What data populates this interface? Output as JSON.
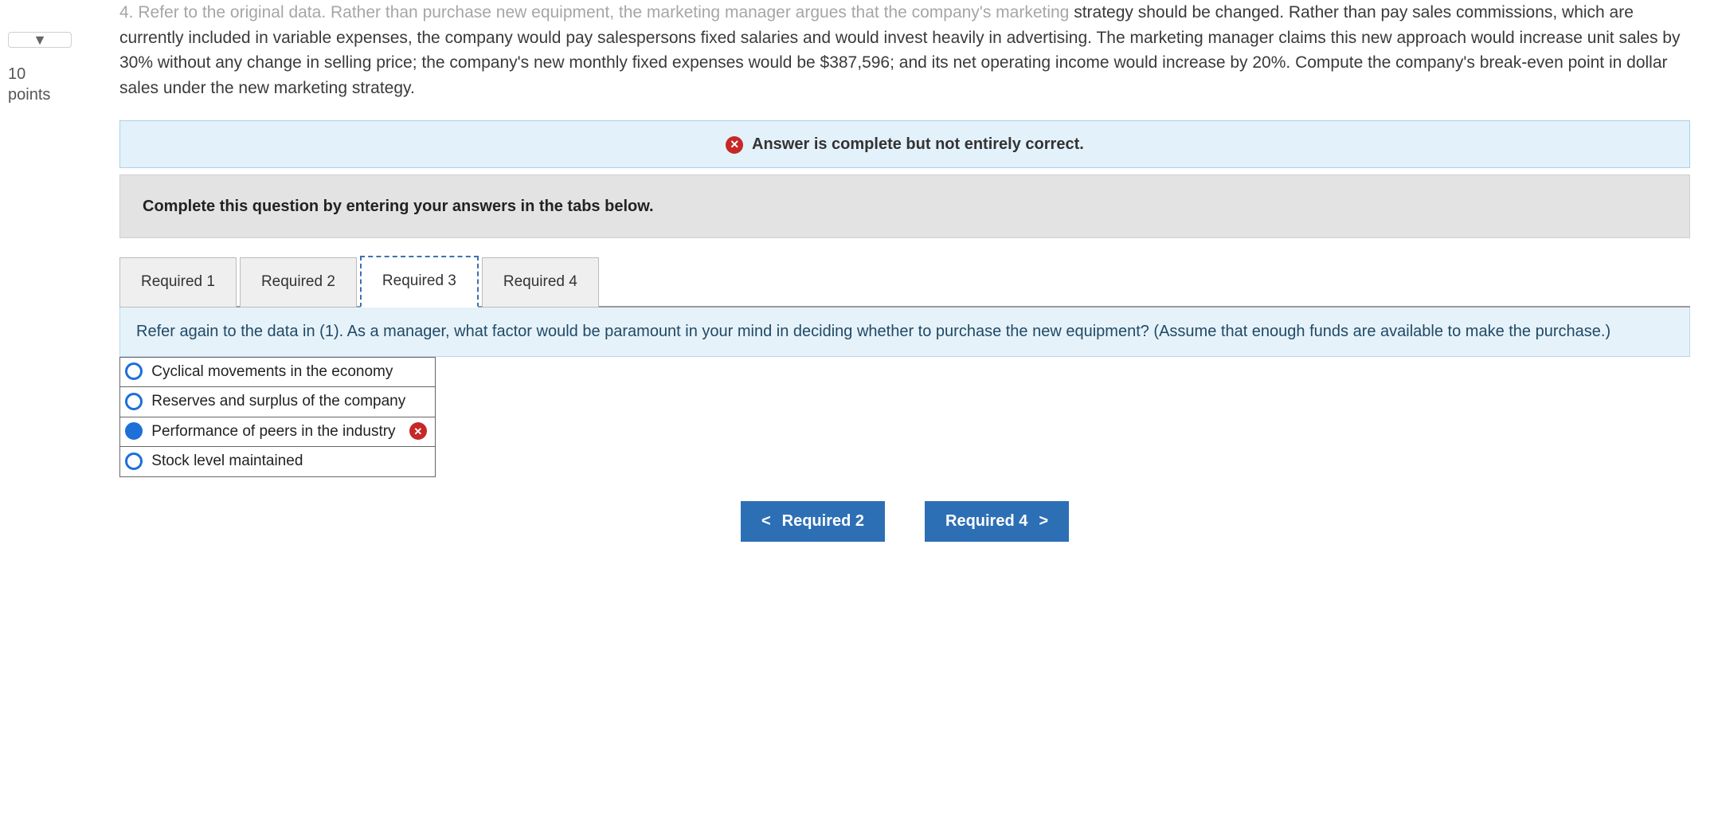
{
  "sidebar": {
    "points_value": "10",
    "points_label": "points"
  },
  "question": {
    "partial_top": "4. Refer to the original data. Rather than purchase new equipment, the marketing manager argues that the company's marketing",
    "body": "strategy should be changed. Rather than pay sales commissions, which are currently included in variable expenses, the company would pay salespersons fixed salaries and would invest heavily in advertising. The marketing manager claims this new approach would increase unit sales by 30% without any change in selling price; the company's new monthly fixed expenses would be $387,596; and its net operating income would increase by 20%. Compute the company's break-even point in dollar sales under the new marketing strategy."
  },
  "status_banner": {
    "text": "Answer is complete but not entirely correct."
  },
  "instruction_banner": "Complete this question by entering your answers in the tabs below.",
  "tabs": [
    {
      "label": "Required 1"
    },
    {
      "label": "Required 2"
    },
    {
      "label": "Required 3",
      "active": true
    },
    {
      "label": "Required 4"
    }
  ],
  "tab_prompt": "Refer again to the data in (1). As a manager, what factor would be paramount in your mind in deciding whether to purchase the new equipment? (Assume that enough funds are available to make the purchase.)",
  "options": [
    {
      "label": "Cyclical movements in the economy",
      "selected": false,
      "wrong": false
    },
    {
      "label": "Reserves and surplus of the company",
      "selected": false,
      "wrong": false
    },
    {
      "label": "Performance of peers in the industry",
      "selected": true,
      "wrong": true
    },
    {
      "label": "Stock level maintained",
      "selected": false,
      "wrong": false
    }
  ],
  "nav": {
    "prev": "Required 2",
    "next": "Required 4"
  }
}
